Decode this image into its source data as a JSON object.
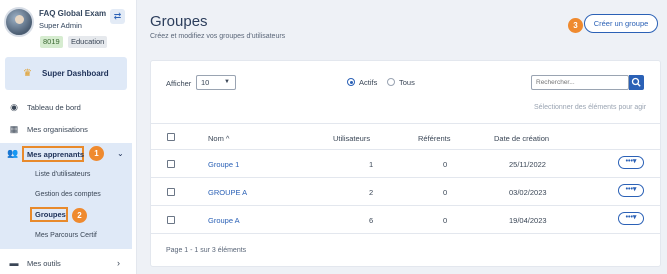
{
  "profile": {
    "org_name": "FAQ Global Exam",
    "role": "Super Admin",
    "org_id": "8019",
    "org_type": "Education",
    "switch_icon": "⇄"
  },
  "sidebar": {
    "super_dashboard": "Super Dashboard",
    "items": [
      {
        "label": "Tableau de bord",
        "icon": "dashboard-icon",
        "glyph": "◉"
      },
      {
        "label": "Mes organisations",
        "icon": "building-icon",
        "glyph": "▦"
      },
      {
        "label": "Mes apprenants",
        "icon": "users-icon",
        "glyph": "👥"
      },
      {
        "label": "Mes outils",
        "icon": "toolbox-icon",
        "glyph": "▬"
      }
    ],
    "subitems": [
      {
        "label": "Liste d'utilisateurs"
      },
      {
        "label": "Gestion des comptes"
      },
      {
        "label": "Groupes"
      },
      {
        "label": "Mes Parcours Certif"
      }
    ]
  },
  "steps": {
    "one": "1",
    "two": "2",
    "three": "3"
  },
  "header": {
    "title": "Groupes",
    "subtitle": "Créez et modifiez vos groupes d'utilisateurs",
    "create_button": "Créer un groupe"
  },
  "filters": {
    "show_label": "Afficher",
    "show_value": "10",
    "radio_active": "Actifs",
    "radio_all": "Tous",
    "search_placeholder": "Rechercher...",
    "select_all": "Sélectionner des éléments pour agir"
  },
  "table": {
    "columns": [
      "Nom",
      "Utilisateurs",
      "Référents",
      "Date de création"
    ],
    "rows": [
      {
        "name": "Groupe 1",
        "users": "1",
        "referents": "0",
        "date": "25/11/2022"
      },
      {
        "name": "GROUPE A",
        "users": "2",
        "referents": "0",
        "date": "03/02/2023"
      },
      {
        "name": "Groupe A",
        "users": "6",
        "referents": "0",
        "date": "19/04/2023"
      }
    ],
    "action_label": "•••▾",
    "pager": "Page 1 - 1 sur 3 éléments"
  },
  "colors": {
    "accent": "#2b61b6",
    "highlight": "#e88a2c",
    "step": "#ef8a2f"
  }
}
